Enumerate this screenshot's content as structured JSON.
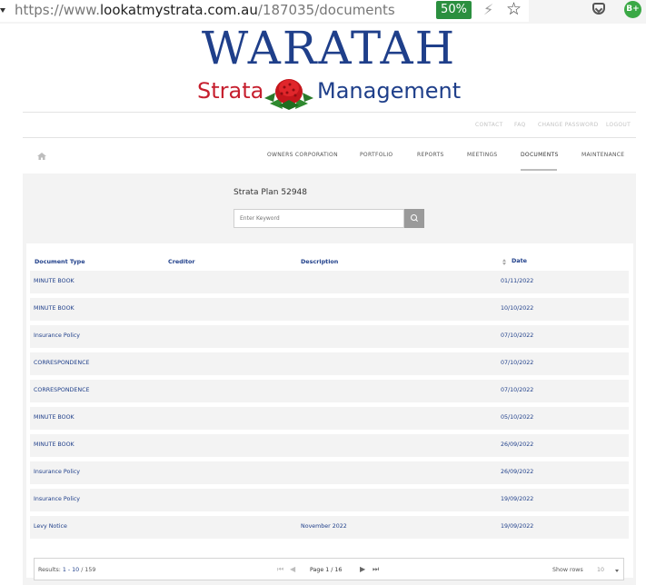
{
  "browser": {
    "url_prefix": "https://www.",
    "url_domain": "lookatmystrata.com.au",
    "url_path": "/187035/documents",
    "zoom": "50%",
    "ext_badge": "B+"
  },
  "logo": {
    "line1": "WARATAH",
    "line2a": "Strata",
    "line2b": "Management"
  },
  "top_links": [
    "CONTACT",
    "FAQ",
    "CHANGE PASSWORD",
    "LOGOUT"
  ],
  "nav": {
    "items": [
      "OWNERS CORPORATION",
      "PORTFOLIO",
      "REPORTS",
      "MEETINGS",
      "DOCUMENTS",
      "MAINTENANCE"
    ],
    "active": "DOCUMENTS"
  },
  "plan_title": "Strata Plan 52948",
  "search": {
    "placeholder": "Enter Keyword"
  },
  "table": {
    "headers": [
      "Document Type",
      "Creditor",
      "Description",
      "Date"
    ],
    "rows": [
      {
        "type": "MINUTE BOOK",
        "creditor": "",
        "description": "",
        "date": "01/11/2022"
      },
      {
        "type": "MINUTE BOOK",
        "creditor": "",
        "description": "",
        "date": "10/10/2022"
      },
      {
        "type": "Insurance Policy",
        "creditor": "",
        "description": "",
        "date": "07/10/2022"
      },
      {
        "type": "CORRESPONDENCE",
        "creditor": "",
        "description": "",
        "date": "07/10/2022"
      },
      {
        "type": "CORRESPONDENCE",
        "creditor": "",
        "description": "",
        "date": "07/10/2022"
      },
      {
        "type": "MINUTE BOOK",
        "creditor": "",
        "description": "",
        "date": "05/10/2022"
      },
      {
        "type": "MINUTE BOOK",
        "creditor": "",
        "description": "",
        "date": "26/09/2022"
      },
      {
        "type": "Insurance Policy",
        "creditor": "",
        "description": "",
        "date": "26/09/2022"
      },
      {
        "type": "Insurance Policy",
        "creditor": "",
        "description": "",
        "date": "19/09/2022"
      },
      {
        "type": "Levy Notice",
        "creditor": "",
        "description": "November 2022",
        "date": "19/09/2022"
      }
    ]
  },
  "footer": {
    "results_label": "Results:",
    "results_range": "1 - 10",
    "results_total": "/ 159",
    "page_label": "Page",
    "page_current": "1",
    "page_total": "/ 16",
    "show_rows_label": "Show rows",
    "rows_value": "10"
  }
}
